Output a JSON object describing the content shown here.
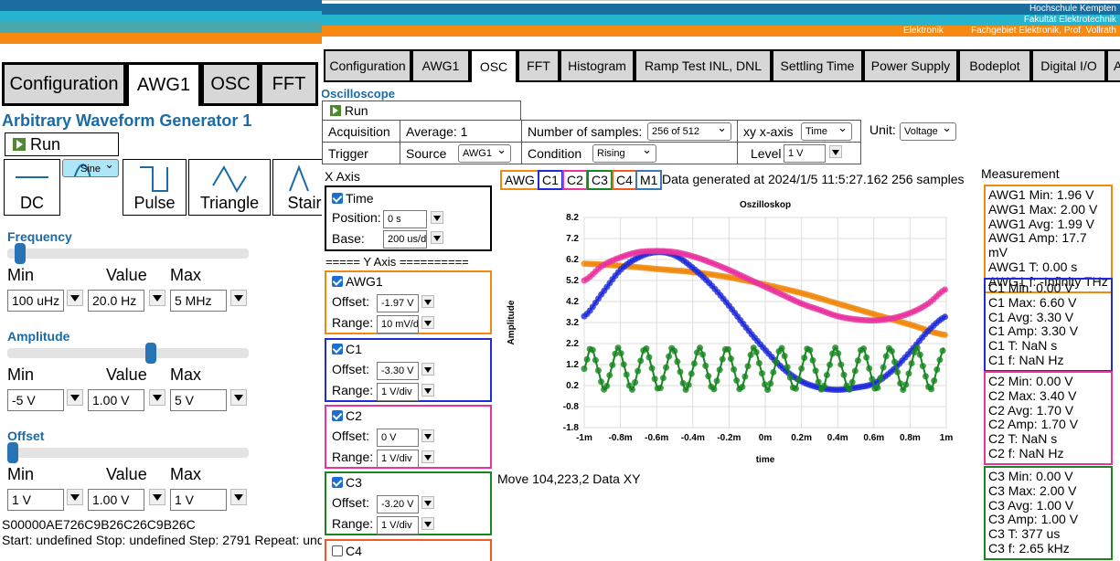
{
  "left": {
    "tabs": [
      "Configuration",
      "AWG1",
      "OSC",
      "FFT"
    ],
    "active_tab": "AWG1",
    "title": "Arbitrary Waveform Generator 1",
    "run_label": "Run",
    "waveforms": [
      "DC",
      "Sine",
      "Pulse",
      "Triangle",
      "Stair"
    ],
    "selected_waveform": "Sine",
    "frequency": {
      "label": "Frequency",
      "min": "100 uHz",
      "value": "20.0 Hz",
      "max": "5 MHz",
      "slider_fraction": 0.03
    },
    "amplitude": {
      "label": "Amplitude",
      "min": "-5 V",
      "value": "1.00 V",
      "max": "5 V",
      "slider_fraction": 0.6
    },
    "offset": {
      "label": "Offset",
      "min": "1 V",
      "value": "1.00 V",
      "max": "1 V",
      "slider_fraction": 0.0
    },
    "col_min": "Min",
    "col_value": "Value",
    "col_max": "Max",
    "hex_string": "S00000AE726C9B26C26C9B26C",
    "status_line": "Start: undefined Stop: undefined Step: 2791 Repeat: und"
  },
  "right": {
    "header": {
      "line1": "Hochschule Kempten",
      "line2": "Fakultät Elektrotechnik",
      "line3a": "Elektronik",
      "line3b": "Fachgebiet Elektronik, Prof. Vollrath"
    },
    "tabs": [
      "Configuration",
      "AWG1",
      "OSC",
      "FFT",
      "Histogram",
      "Ramp Test INL, DNL",
      "Settling Time",
      "Power Supply",
      "Bodeplot",
      "Digital I/O",
      "A"
    ],
    "active_tab": "OSC",
    "section_title": "Oscilloscope",
    "run_label": "Run",
    "acquisition": {
      "label": "Acquisition",
      "average": "Average: 1",
      "samples_label": "Number of samples:",
      "samples_value": "256 of 512",
      "xy_label": "xy x-axis",
      "xy_value": "Time",
      "unit_label": "Unit:",
      "unit_value": "Voltage"
    },
    "trigger": {
      "label": "Trigger",
      "source_label": "Source",
      "source_value": "AWG1",
      "condition_label": "Condition",
      "condition_value": "Rising",
      "level_label": "Level",
      "level_value": "1 V"
    },
    "xaxis": {
      "title": "X Axis",
      "time_label": "Time",
      "position_label": "Position:",
      "position_value": "0 s",
      "base_label": "Base:",
      "base_value": "200 us/div"
    },
    "yaxis_title": "===== Y Axis ==========",
    "channels": [
      {
        "name": "AWG1",
        "checked": true,
        "offset": "-1.97 V",
        "range": "10 mV/div",
        "color": "#f0890f"
      },
      {
        "name": "C1",
        "checked": true,
        "offset": "-3.30 V",
        "range": "1 V/div",
        "color": "#1f2bd9"
      },
      {
        "name": "C2",
        "checked": true,
        "offset": "0 V",
        "range": "1 V/div",
        "color": "#e8339f"
      },
      {
        "name": "C3",
        "checked": true,
        "offset": "-3.20 V",
        "range": "1 V/div",
        "color": "#17861f"
      },
      {
        "name": "C4",
        "checked": false,
        "color": "#f05a1e"
      }
    ],
    "offset_label": "Offset:",
    "range_label": "Range:",
    "legend": [
      {
        "label": "AWG",
        "color": "#f0890f"
      },
      {
        "label": "C1",
        "color": "#1f2bd9"
      },
      {
        "label": "C2",
        "color": "#e8339f"
      },
      {
        "label": "C3",
        "color": "#17861f"
      },
      {
        "label": "C4",
        "color": "#f05a1e"
      },
      {
        "label": "M1",
        "color": "#3a78b8"
      }
    ],
    "data_status": "Data generated at 2024/1/5 11:5:27.162 256 samples",
    "move_status": "Move 104,223,2 Data XY",
    "measurement_title": "Measurement",
    "measurements": [
      {
        "color": "#f0890f",
        "lines": [
          "AWG1 Min: 1.96 V",
          "AWG1 Max: 2.00 V",
          "AWG1 Avg: 1.99 V",
          "AWG1 Amp: 17.7 mV",
          "AWG1 T: 0.00 s",
          "AWG1 f: -Infinity THz"
        ]
      },
      {
        "color": "#1f2bd9",
        "lines": [
          "C1 Min: 0.00 V",
          "C1 Max: 6.60 V",
          "C1 Avg: 3.30 V",
          "C1 Amp: 3.30 V",
          "C1 T: NaN s",
          "C1 f: NaN Hz"
        ]
      },
      {
        "color": "#e8339f",
        "lines": [
          "C2 Min: 0.00 V",
          "C2 Max: 3.40 V",
          "C2 Avg: 1.70 V",
          "C2 Amp: 1.70 V",
          "C2 T: NaN s",
          "C2 f: NaN Hz"
        ]
      },
      {
        "color": "#17861f",
        "lines": [
          "C3 Min: 0.00 V",
          "C3 Max: 2.00 V",
          "C3 Avg: 1.00 V",
          "C3 Amp: 1.00 V",
          "C3 T: 377 us",
          "C3 f: 2.65 kHz"
        ]
      }
    ]
  },
  "chart_data": {
    "type": "line",
    "title": "Oszilloskop",
    "xlabel": "time",
    "ylabel": "Amplitude",
    "xlim": [
      -1,
      1
    ],
    "ylim": [
      -1.8,
      8.2
    ],
    "x_ticks": [
      "-1m",
      "-0.8m",
      "-0.6m",
      "-0.4m",
      "-0.2m",
      "0m",
      "0.2m",
      "0.4m",
      "0.6m",
      "0.8m",
      "1m"
    ],
    "y_ticks": [
      "8.2",
      "7.2",
      "6.2",
      "5.2",
      "4.2",
      "3.2",
      "2.2",
      "1.2",
      "0.2",
      "-0.8",
      "-1.8"
    ],
    "grid": true,
    "series": [
      {
        "name": "AWG",
        "color": "#f0890f",
        "x": [
          -1,
          -0.8,
          -0.6,
          -0.4,
          -0.2,
          0,
          0.2,
          0.4,
          0.6,
          0.8,
          1
        ],
        "y": [
          6.0,
          5.9,
          5.75,
          5.6,
          5.35,
          5.0,
          4.6,
          4.1,
          3.6,
          3.1,
          2.6
        ]
      },
      {
        "name": "C1",
        "color": "#1f2bd9",
        "x": [
          -1,
          -0.9,
          -0.8,
          -0.7,
          -0.6,
          -0.5,
          -0.4,
          -0.3,
          -0.2,
          -0.1,
          0,
          0.1,
          0.2,
          0.3,
          0.4,
          0.5,
          0.6,
          0.7,
          0.8,
          0.9,
          1
        ],
        "y": [
          3.5,
          4.6,
          5.7,
          6.3,
          6.55,
          6.4,
          5.8,
          5.0,
          4.0,
          2.9,
          1.9,
          1.0,
          0.4,
          0.1,
          0.0,
          0.1,
          0.3,
          0.9,
          1.8,
          2.8,
          3.5
        ]
      },
      {
        "name": "C2",
        "color": "#e8339f",
        "x": [
          -1,
          -0.9,
          -0.8,
          -0.7,
          -0.6,
          -0.5,
          -0.4,
          -0.3,
          -0.2,
          -0.1,
          0,
          0.1,
          0.2,
          0.3,
          0.4,
          0.5,
          0.6,
          0.7,
          0.8,
          0.9,
          1
        ],
        "y": [
          5.2,
          5.9,
          6.3,
          6.55,
          6.6,
          6.55,
          6.35,
          6.05,
          5.7,
          5.3,
          4.9,
          4.5,
          4.1,
          3.8,
          3.5,
          3.35,
          3.3,
          3.4,
          3.65,
          4.1,
          4.8
        ]
      },
      {
        "name": "C3",
        "color": "#17861f",
        "x": [
          -1,
          -0.9625,
          -0.925,
          -0.8875,
          -0.85,
          -0.8125,
          -0.775,
          -0.7375,
          -0.7,
          -0.6625,
          -0.625,
          -0.5875,
          -0.55,
          -0.5125,
          -0.475,
          -0.4375,
          -0.4,
          -0.3625,
          -0.325,
          -0.2875,
          -0.25,
          -0.2125,
          -0.175,
          -0.1375,
          -0.1,
          -0.0625,
          -0.025,
          0.0125,
          0.05,
          0.0875,
          0.125,
          0.1625,
          0.2,
          0.2375,
          0.275,
          0.3125,
          0.35,
          0.3875,
          0.425,
          0.4625,
          0.5,
          0.5375,
          0.575,
          0.6125,
          0.65,
          0.6875,
          0.725,
          0.7625,
          0.8,
          0.8375,
          0.875,
          0.9125,
          0.95,
          0.9875
        ],
        "y": [
          1.0,
          2.0,
          1.0,
          0.0,
          1.0,
          2.0,
          1.0,
          0.0,
          1.0,
          2.0,
          1.0,
          0.0,
          1.0,
          2.0,
          1.0,
          0.0,
          1.0,
          2.0,
          1.0,
          0.0,
          1.0,
          2.0,
          1.0,
          0.0,
          1.0,
          2.0,
          1.0,
          0.0,
          1.0,
          2.0,
          1.0,
          0.0,
          1.0,
          2.0,
          1.0,
          0.0,
          1.0,
          2.0,
          1.0,
          0.0,
          1.0,
          2.0,
          1.0,
          0.0,
          1.0,
          2.0,
          1.0,
          0.0,
          1.0,
          2.0,
          1.0,
          0.0,
          1.0,
          2.0
        ]
      }
    ]
  }
}
